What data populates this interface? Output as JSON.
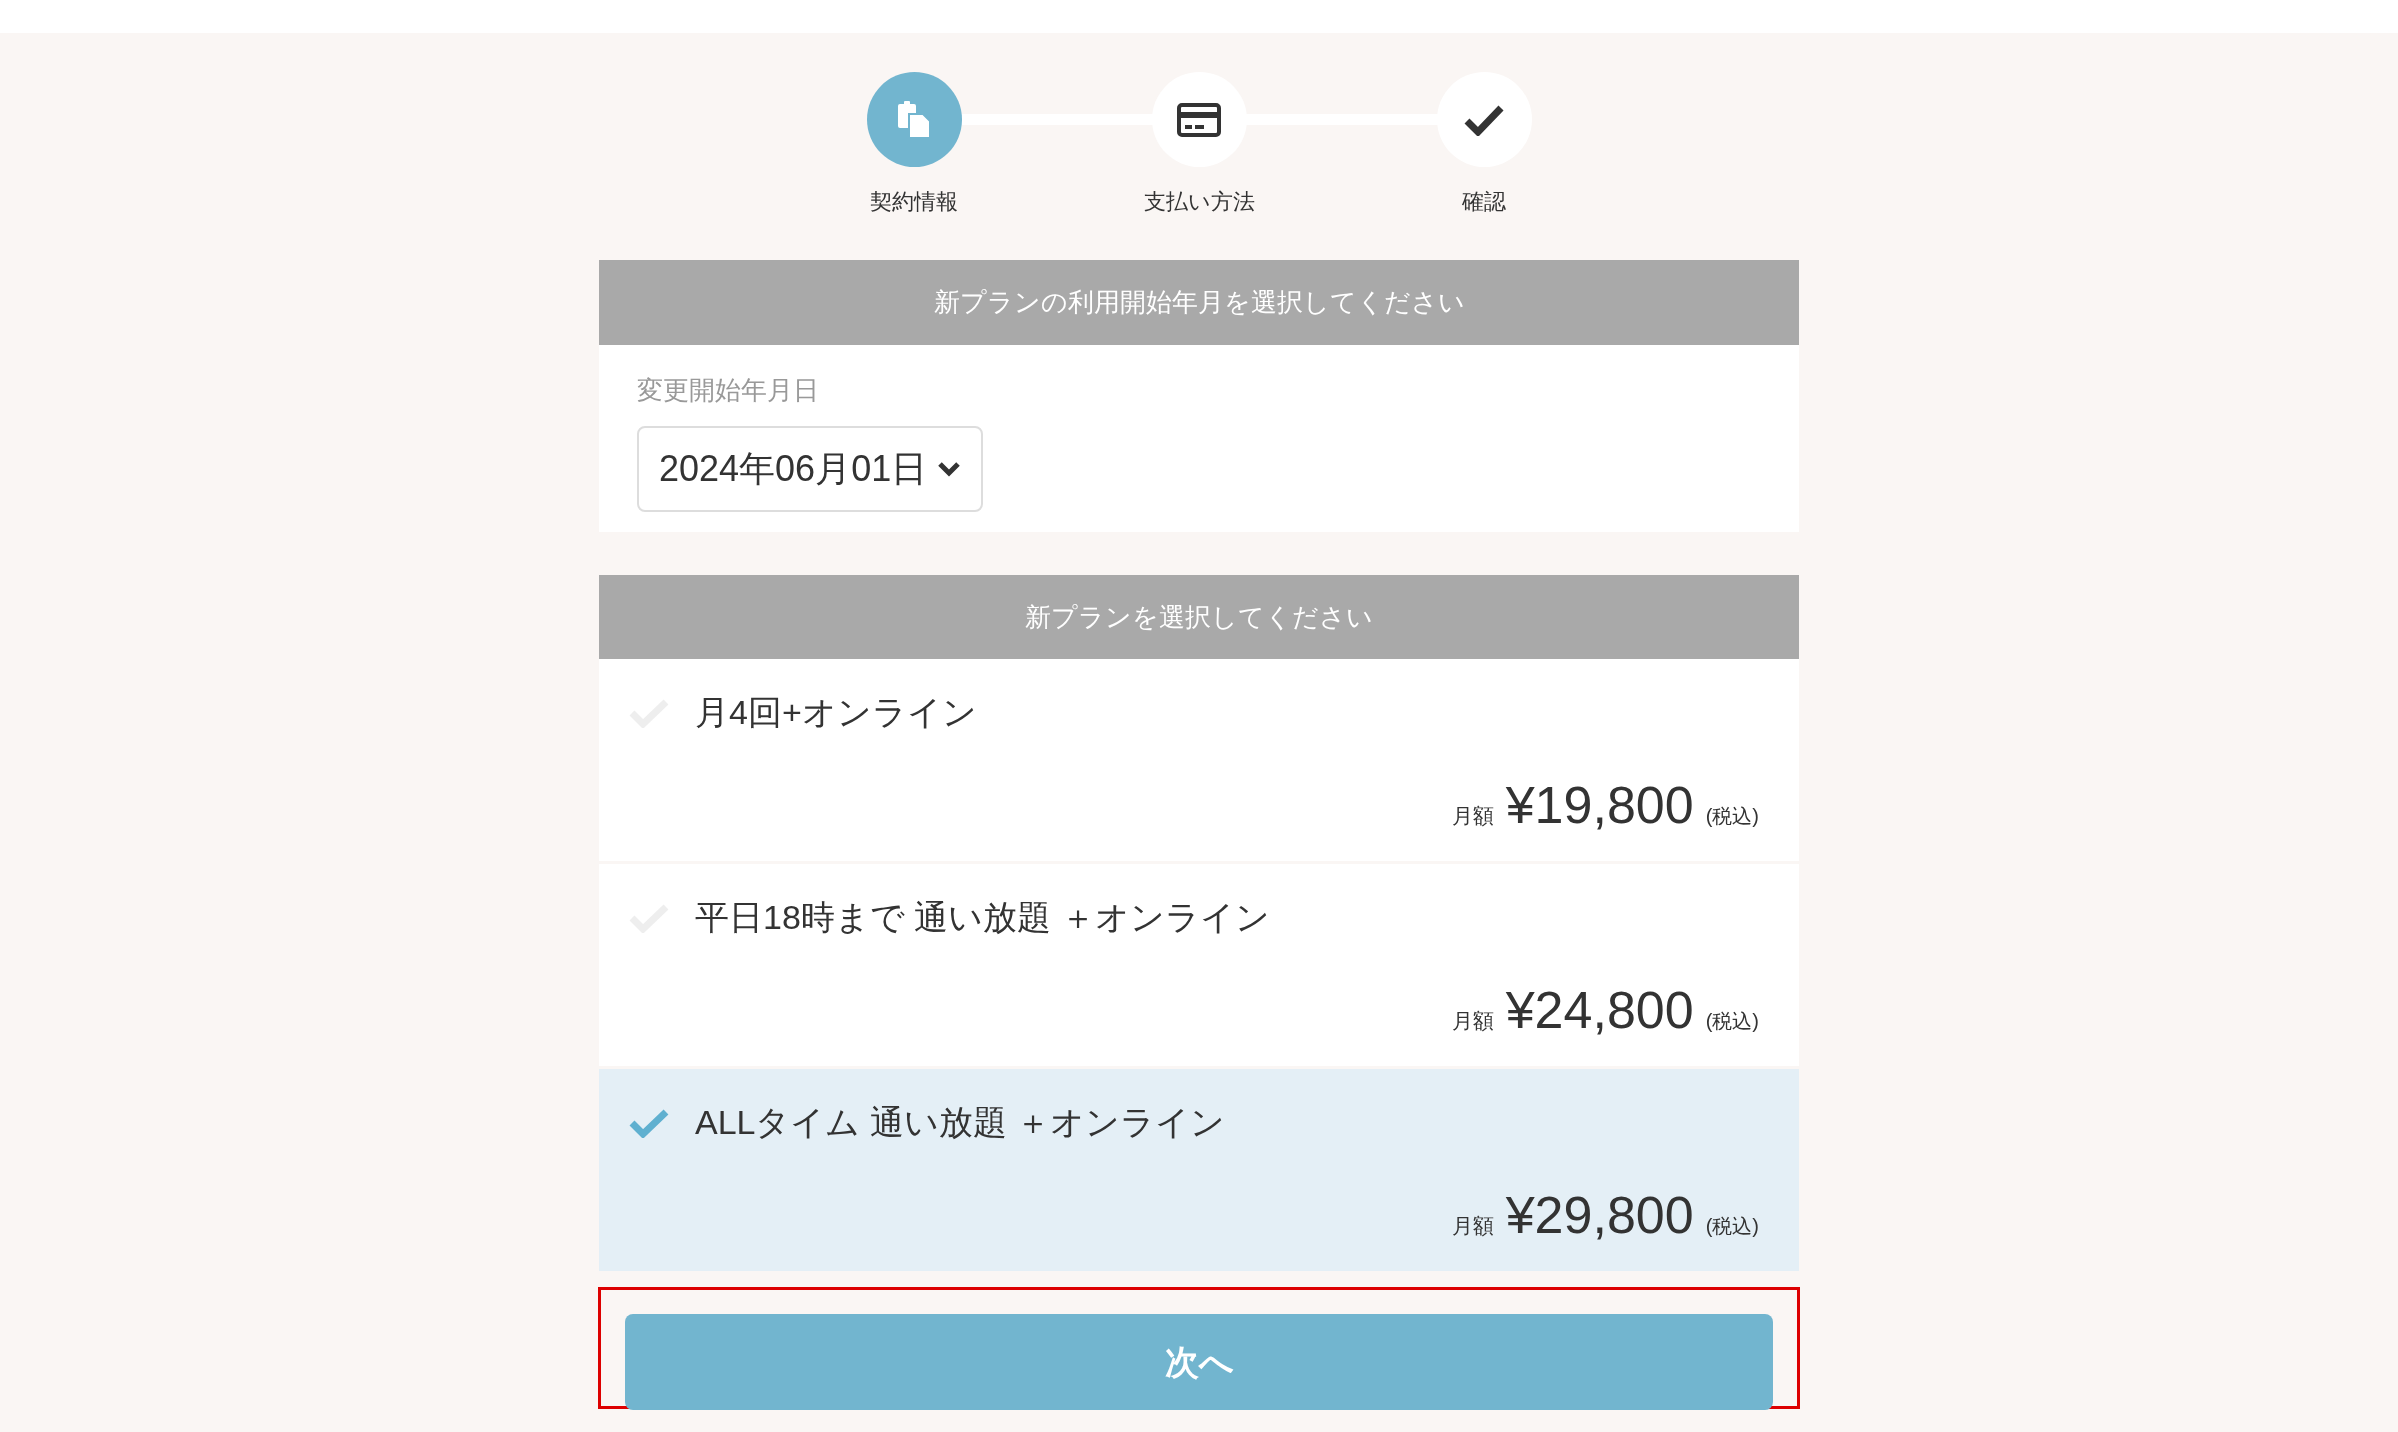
{
  "steps": [
    {
      "label": "契約情報",
      "kind": "documents",
      "active": true
    },
    {
      "label": "支払い方法",
      "kind": "card",
      "active": false
    },
    {
      "label": "確認",
      "kind": "check",
      "active": false
    }
  ],
  "date_section": {
    "heading": "新プランの利用開始年月を選択してください",
    "field_label": "変更開始年月日",
    "value": "2024年06月01日"
  },
  "plan_section": {
    "heading": "新プランを選択してください",
    "plans": [
      {
        "name": "月4回+オンライン",
        "price_label": "月額",
        "price": "¥19,800",
        "tax_note": "(税込)",
        "selected": false
      },
      {
        "name": "平日18時まで 通い放題 ＋オンライン",
        "price_label": "月額",
        "price": "¥24,800",
        "tax_note": "(税込)",
        "selected": false
      },
      {
        "name": "ALLタイム 通い放題 ＋オンライン",
        "price_label": "月額",
        "price": "¥29,800",
        "tax_note": "(税込)",
        "selected": true
      }
    ]
  },
  "next_button": {
    "label": "次へ",
    "highlighted": true
  }
}
